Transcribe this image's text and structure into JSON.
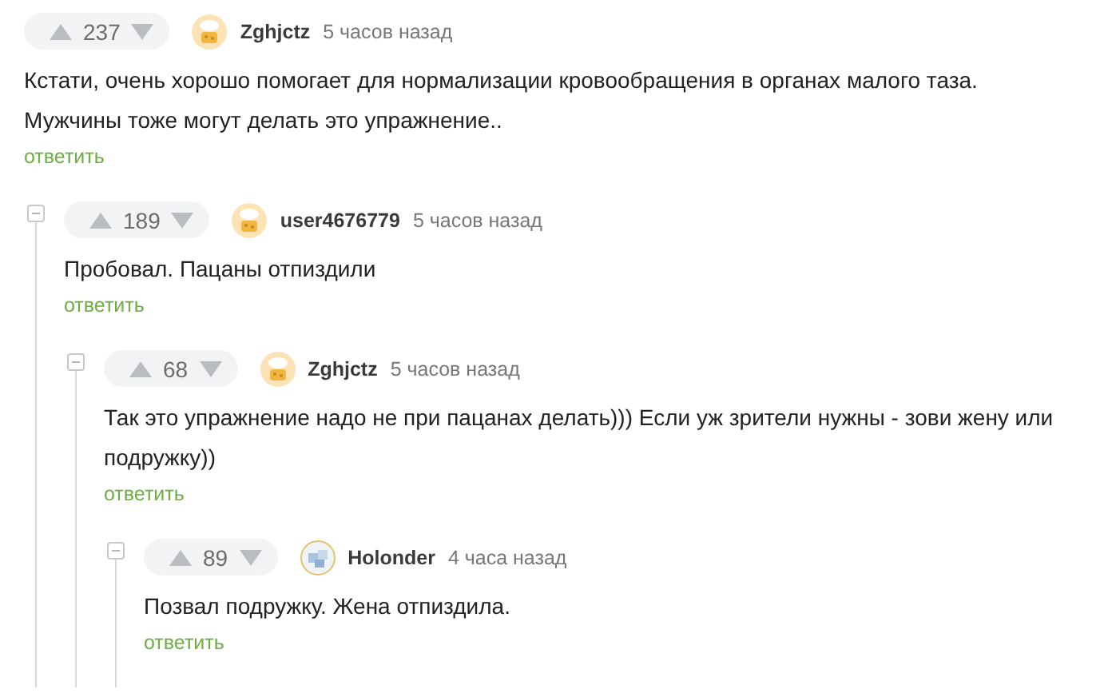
{
  "comments": [
    {
      "votes": "237",
      "author": "Zghjctz",
      "avatar": {
        "kind": "chef"
      },
      "time": "5 часов назад",
      "text": "Кстати, очень хорошо помогает для нормализации кровообращения в органах малого таза. Мужчины тоже могут делать это упражнение..",
      "reply": "ответить",
      "children": [
        {
          "votes": "189",
          "author": "user4676779",
          "avatar": {
            "kind": "chef"
          },
          "time": "5 часов назад",
          "text": "Пробовал. Пацаны отпиздили",
          "reply": "ответить",
          "children": [
            {
              "votes": "68",
              "author": "Zghjctz",
              "avatar": {
                "kind": "chef"
              },
              "time": "5 часов назад",
              "text": "Так это упражнение надо не при пацанах делать))) Если уж зрители нужны - зови жену или подружку))",
              "reply": "ответить",
              "children": [
                {
                  "votes": "89",
                  "author": "Holonder",
                  "avatar": {
                    "kind": "ice"
                  },
                  "time": "4 часа назад",
                  "text": "Позвал подружку. Жена отпиздила.",
                  "reply": "ответить"
                }
              ]
            }
          ]
        }
      ]
    }
  ]
}
